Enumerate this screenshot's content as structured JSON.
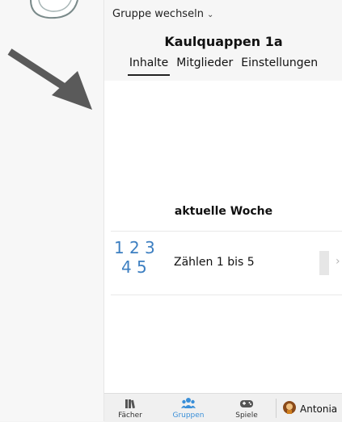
{
  "header": {
    "switch_label": "Gruppe wechseln",
    "group_title": "Kaulquappen 1a",
    "tabs": [
      {
        "label": "Inhalte",
        "active": true
      },
      {
        "label": "Mitglieder",
        "active": false
      },
      {
        "label": "Einstellungen",
        "active": false
      }
    ]
  },
  "week": {
    "heading": "aktuelle Woche",
    "lessons": [
      {
        "title": "Zählen 1 bis 5",
        "icon_digits": [
          "1",
          "2",
          "3",
          "4",
          "5"
        ]
      }
    ]
  },
  "bottom_nav": {
    "items": [
      {
        "label": "Fächer",
        "icon": "books-icon"
      },
      {
        "label": "Gruppen",
        "icon": "group-icon",
        "active": true
      },
      {
        "label": "Spiele",
        "icon": "gamepad-icon"
      }
    ],
    "profile_name": "Antonia"
  },
  "colors": {
    "accent": "#3a8fd8",
    "arrow": "#5a5a5a",
    "lesson_digits": "#3d7fc1"
  }
}
